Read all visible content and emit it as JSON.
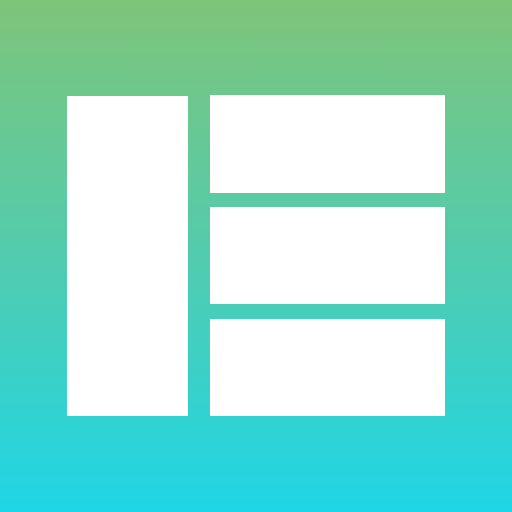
{
  "icon": {
    "name": "layout-grid-icon",
    "colors": {
      "gradient_top": "#7ec47a",
      "gradient_bottom": "#1fd6e6",
      "panel": "#ffffff"
    },
    "panels": [
      {
        "id": "left"
      },
      {
        "id": "right-top"
      },
      {
        "id": "right-middle"
      },
      {
        "id": "right-bottom"
      }
    ]
  }
}
